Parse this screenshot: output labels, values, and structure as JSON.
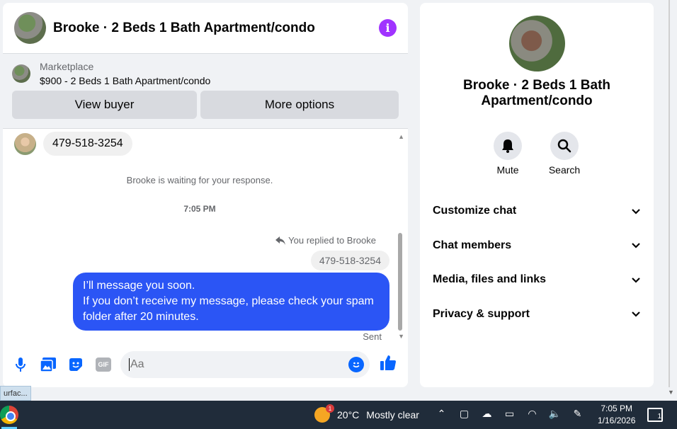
{
  "chat": {
    "title": "Brooke · 2 Beds 1 Bath Apartment/condo",
    "listing": {
      "label": "Marketplace",
      "price_title": "$900 - 2 Beds 1 Bath Apartment/condo",
      "view_buyer": "View buyer",
      "more_options": "More options"
    },
    "messages": {
      "incoming_text": "479-518-3254",
      "waiting_note": "Brooke is waiting for your response.",
      "time": "7:05 PM",
      "replied_note": "You replied to Brooke",
      "quoted_text": "479-518-3254",
      "outgoing_line1": "I’ll message you soon.",
      "outgoing_line2": "If you don’t receive my message, please check your spam folder after 20 minutes.",
      "sent_status": "Sent"
    },
    "composer": {
      "placeholder": "Aa",
      "gif_label": "GIF"
    }
  },
  "info": {
    "title": "Brooke · 2 Beds 1 Bath Apartment/condo",
    "actions": [
      {
        "label": "Mute",
        "icon": "bell-icon"
      },
      {
        "label": "Search",
        "icon": "search-icon"
      }
    ],
    "menu": [
      "Customize chat",
      "Chat members",
      "Media, files and links",
      "Privacy & support"
    ]
  },
  "tooltip": "urfac...",
  "taskbar": {
    "weather_badge": "1",
    "temperature": "20°C",
    "condition": "Mostly clear",
    "time": "7:05 PM",
    "date": "1/16/2026",
    "notification_count": "1"
  },
  "colors": {
    "accent_blue": "#0866ff",
    "bubble_blue": "#2b55f5",
    "info_purple": "#a033ff",
    "taskbar": "#202c3a"
  }
}
